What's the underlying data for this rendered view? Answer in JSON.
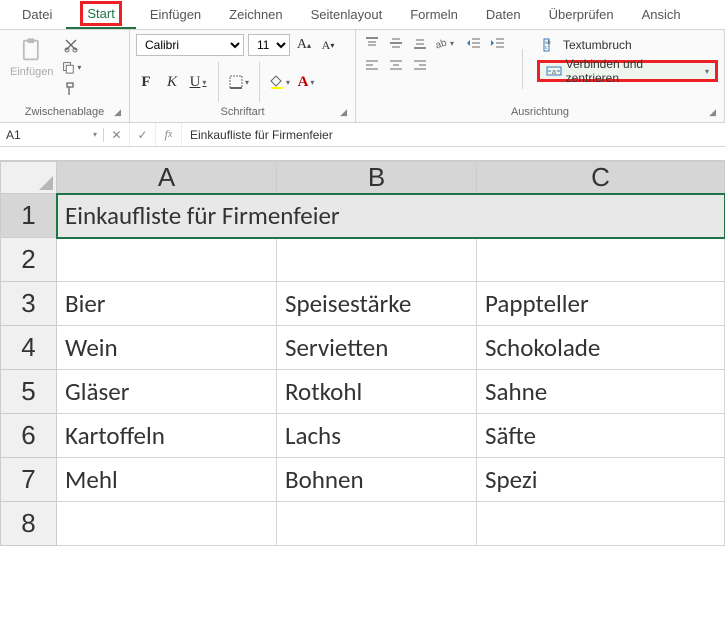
{
  "tabs": [
    "Datei",
    "Start",
    "Einfügen",
    "Zeichnen",
    "Seitenlayout",
    "Formeln",
    "Daten",
    "Überprüfen",
    "Ansich"
  ],
  "active_tab": 1,
  "clipboard": {
    "paste": "Einfügen",
    "label": "Zwischenablage"
  },
  "font": {
    "name": "Calibri",
    "size": "11",
    "label": "Schriftart",
    "bold": "F",
    "italic": "K",
    "underline": "U"
  },
  "alignment": {
    "label": "Ausrichtung",
    "wrap": "Textumbruch",
    "merge": "Verbinden und zentrieren"
  },
  "namebox": "A1",
  "formula": "Einkaufliste für Firmenfeier",
  "columns": [
    "A",
    "B",
    "C"
  ],
  "rows": [
    "1",
    "2",
    "3",
    "4",
    "5",
    "6",
    "7",
    "8"
  ],
  "cells": {
    "title": "Einkaufliste für Firmenfeier",
    "r3": {
      "a": "Bier",
      "b": "Speisestärke",
      "c": "Pappteller"
    },
    "r4": {
      "a": "Wein",
      "b": "Servietten",
      "c": "Schokolade"
    },
    "r5": {
      "a": "Gläser",
      "b": "Rotkohl",
      "c": "Sahne"
    },
    "r6": {
      "a": "Kartoffeln",
      "b": "Lachs",
      "c": "Säfte"
    },
    "r7": {
      "a": "Mehl",
      "b": "Bohnen",
      "c": "Spezi"
    }
  },
  "chart_data": {
    "type": "table",
    "title": "Einkaufliste für Firmenfeier",
    "columns": [
      "A",
      "B",
      "C"
    ],
    "rows": [
      [
        "Bier",
        "Speisestärke",
        "Pappteller"
      ],
      [
        "Wein",
        "Servietten",
        "Schokolade"
      ],
      [
        "Gläser",
        "Rotkohl",
        "Sahne"
      ],
      [
        "Kartoffeln",
        "Lachs",
        "Säfte"
      ],
      [
        "Mehl",
        "Bohnen",
        "Spezi"
      ]
    ]
  }
}
